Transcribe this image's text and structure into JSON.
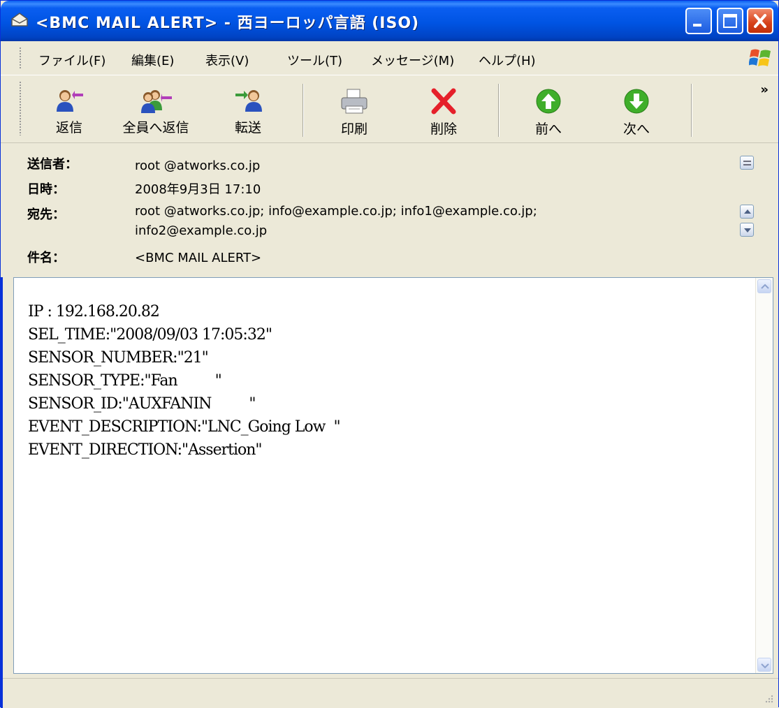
{
  "window": {
    "title": "<BMC MAIL ALERT> - 西ヨーロッパ言語 (ISO)",
    "controls": [
      "minimize",
      "maximize",
      "close"
    ]
  },
  "menu": {
    "items": [
      "ファイル(F)",
      "編集(E)",
      "表示(V)",
      "ツール(T)",
      "メッセージ(M)",
      "ヘルプ(H)"
    ]
  },
  "toolbar": {
    "buttons": [
      {
        "label": "返信",
        "icon": "reply-icon"
      },
      {
        "label": "全員へ返信",
        "icon": "reply-all-icon"
      },
      {
        "label": "転送",
        "icon": "forward-icon"
      },
      {
        "label": "印刷",
        "icon": "print-icon"
      },
      {
        "label": "削除",
        "icon": "delete-icon"
      },
      {
        "label": "前へ",
        "icon": "previous-icon"
      },
      {
        "label": "次へ",
        "icon": "next-icon"
      }
    ],
    "overflow": "»"
  },
  "header": {
    "from_label": "送信者：",
    "from_value": "root @atworks.co.jp",
    "date_label": "日時：",
    "date_value": "2008年9月3日 17:10",
    "to_label": "宛先：",
    "to_line1": "root @atworks.co.jp; info@example.co.jp; info1@example.co.jp;",
    "to_line2": "info2@example.co.jp",
    "subject_label": "件名：",
    "subject_value": "<BMC MAIL ALERT>"
  },
  "body": {
    "lines": [
      "IP : 192.168.20.82",
      "SEL_TIME:\"2008/09/03 17:05:32\"",
      "SENSOR_NUMBER:\"21\"",
      "SENSOR_TYPE:\"Fan         \"",
      "SENSOR_ID:\"AUXFANIN         \"",
      "EVENT_DESCRIPTION:\"LNC_Going Low  \"",
      "EVENT_DIRECTION:\"Assertion\""
    ]
  },
  "colors": {
    "titlebar": "#0054e3",
    "face": "#ece9d8",
    "border": "#7f9db9"
  }
}
